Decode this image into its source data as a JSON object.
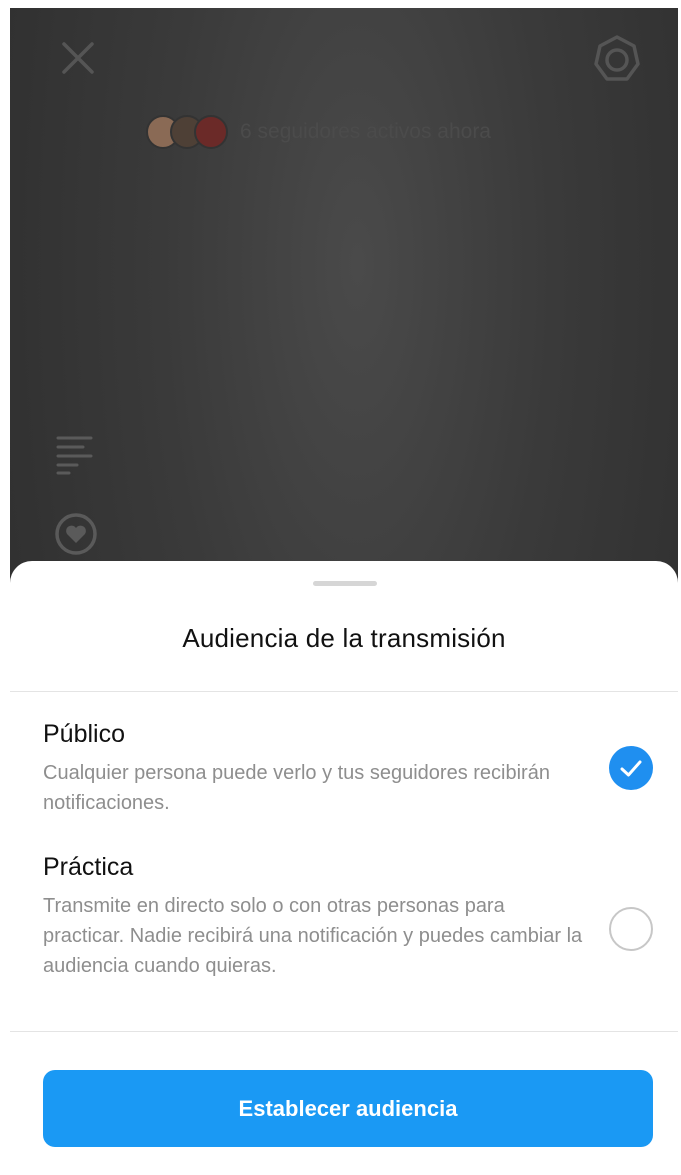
{
  "live_screen": {
    "viewers_text": "6 seguidores activos ahora",
    "icons": [
      "close-icon",
      "gear-icon",
      "comments-icon",
      "badge-icon"
    ]
  },
  "sheet": {
    "title": "Audiencia de la transmisión",
    "options": [
      {
        "label": "Público",
        "description": "Cualquier persona puede verlo y tus seguidores recibirán notificaciones.",
        "selected": true
      },
      {
        "label": "Práctica",
        "description": "Transmite en directo solo o con otras personas para practicar. Nadie recibirá una notificación y puedes cambiar la audiencia cuando quieras.",
        "selected": false
      }
    ],
    "button_label": "Establecer audiencia"
  },
  "colors": {
    "accent": "#1a99f4",
    "check": "#1f8ff0",
    "overlay": "#3a3a3a"
  }
}
